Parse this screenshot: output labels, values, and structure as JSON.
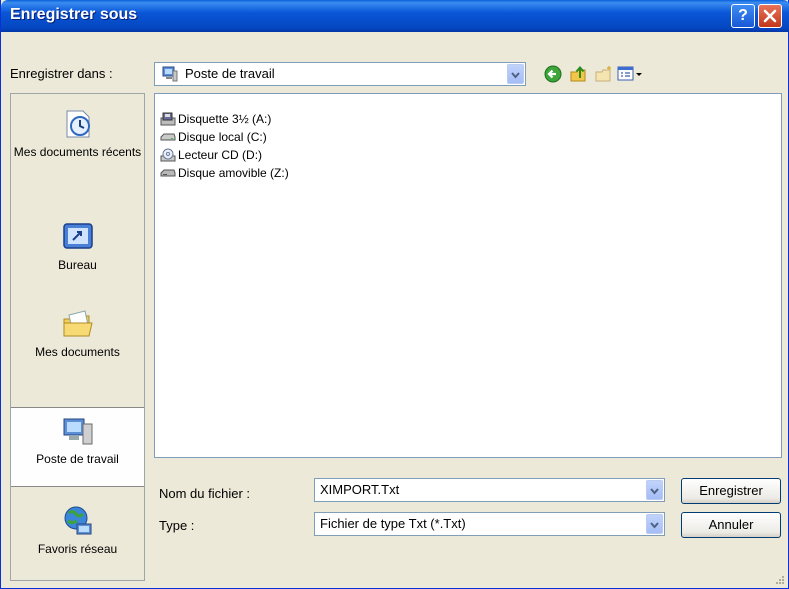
{
  "window": {
    "title": "Enregistrer sous",
    "help_button": "?",
    "close_button": "✕"
  },
  "toolbar": {
    "save_in_label": "Enregistrer dans :",
    "location": "Poste de travail",
    "icons": [
      "back-icon",
      "up-folder-icon",
      "new-folder-icon",
      "view-menu-icon"
    ]
  },
  "places": [
    {
      "label": "Mes documents récents",
      "icon": "recent-documents-icon"
    },
    {
      "label": "Bureau",
      "icon": "desktop-icon"
    },
    {
      "label": "Mes documents",
      "icon": "my-documents-icon"
    },
    {
      "label": "Poste de travail",
      "icon": "my-computer-icon",
      "selected": true
    },
    {
      "label": "Favoris réseau",
      "icon": "network-places-icon"
    }
  ],
  "files": [
    {
      "name": "Disquette 3½ (A:)",
      "icon": "floppy-drive-icon"
    },
    {
      "name": "Disque local (C:)",
      "icon": "hard-drive-icon"
    },
    {
      "name": "Lecteur CD (D:)",
      "icon": "cd-drive-icon"
    },
    {
      "name": "Disque amovible (Z:)",
      "icon": "removable-drive-icon"
    }
  ],
  "form": {
    "filename_label": "Nom du fichier :",
    "filename_value": "XIMPORT.Txt",
    "type_label": "Type :",
    "type_value": "Fichier de type Txt (*.Txt)"
  },
  "buttons": {
    "save": "Enregistrer",
    "cancel": "Annuler"
  },
  "colors": {
    "titlebar": "#0a56d8",
    "face": "#ece9d8",
    "close": "#c3361a"
  }
}
